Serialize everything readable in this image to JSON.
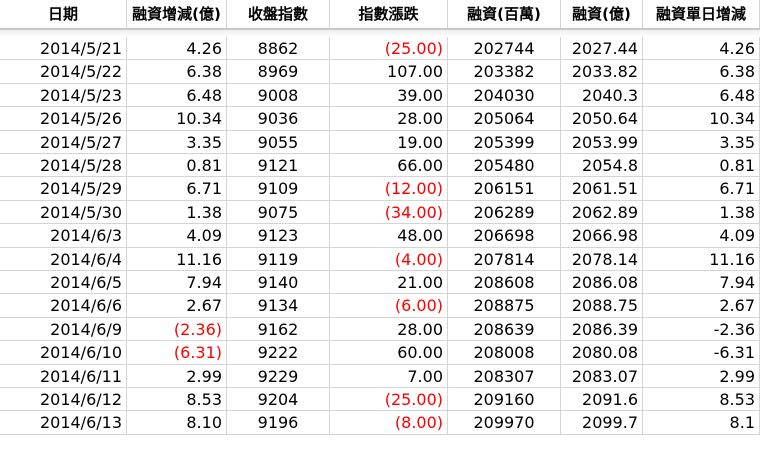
{
  "headers": [
    "日期",
    "融資增減(億)",
    "收盤指數",
    "指數漲跌",
    "融資(百萬)",
    "融資(億)",
    "融資單日增減"
  ],
  "colors": {
    "negative": "#ff0000",
    "grid": "#d4d4d4"
  },
  "rows": [
    [
      "2014/5/21",
      "4.26",
      "8862",
      "(25.00)",
      "202744",
      "2027.44",
      "4.26"
    ],
    [
      "2014/5/22",
      "6.38",
      "8969",
      "107.00",
      "203382",
      "2033.82",
      "6.38"
    ],
    [
      "2014/5/23",
      "6.48",
      "9008",
      "39.00",
      "204030",
      "2040.3",
      "6.48"
    ],
    [
      "2014/5/26",
      "10.34",
      "9036",
      "28.00",
      "205064",
      "2050.64",
      "10.34"
    ],
    [
      "2014/5/27",
      "3.35",
      "9055",
      "19.00",
      "205399",
      "2053.99",
      "3.35"
    ],
    [
      "2014/5/28",
      "0.81",
      "9121",
      "66.00",
      "205480",
      "2054.8",
      "0.81"
    ],
    [
      "2014/5/29",
      "6.71",
      "9109",
      "(12.00)",
      "206151",
      "2061.51",
      "6.71"
    ],
    [
      "2014/5/30",
      "1.38",
      "9075",
      "(34.00)",
      "206289",
      "2062.89",
      "1.38"
    ],
    [
      "2014/6/3",
      "4.09",
      "9123",
      "48.00",
      "206698",
      "2066.98",
      "4.09"
    ],
    [
      "2014/6/4",
      "11.16",
      "9119",
      "(4.00)",
      "207814",
      "2078.14",
      "11.16"
    ],
    [
      "2014/6/5",
      "7.94",
      "9140",
      "21.00",
      "208608",
      "2086.08",
      "7.94"
    ],
    [
      "2014/6/6",
      "2.67",
      "9134",
      "(6.00)",
      "208875",
      "2088.75",
      "2.67"
    ],
    [
      "2014/6/9",
      "(2.36)",
      "9162",
      "28.00",
      "208639",
      "2086.39",
      "-2.36"
    ],
    [
      "2014/6/10",
      "(6.31)",
      "9222",
      "60.00",
      "208008",
      "2080.08",
      "-6.31"
    ],
    [
      "2014/6/11",
      "2.99",
      "9229",
      "7.00",
      "208307",
      "2083.07",
      "2.99"
    ],
    [
      "2014/6/12",
      "8.53",
      "9204",
      "(25.00)",
      "209160",
      "2091.6",
      "8.53"
    ],
    [
      "2014/6/13",
      "8.10",
      "9196",
      "(8.00)",
      "209970",
      "2099.7",
      "8.1"
    ]
  ]
}
